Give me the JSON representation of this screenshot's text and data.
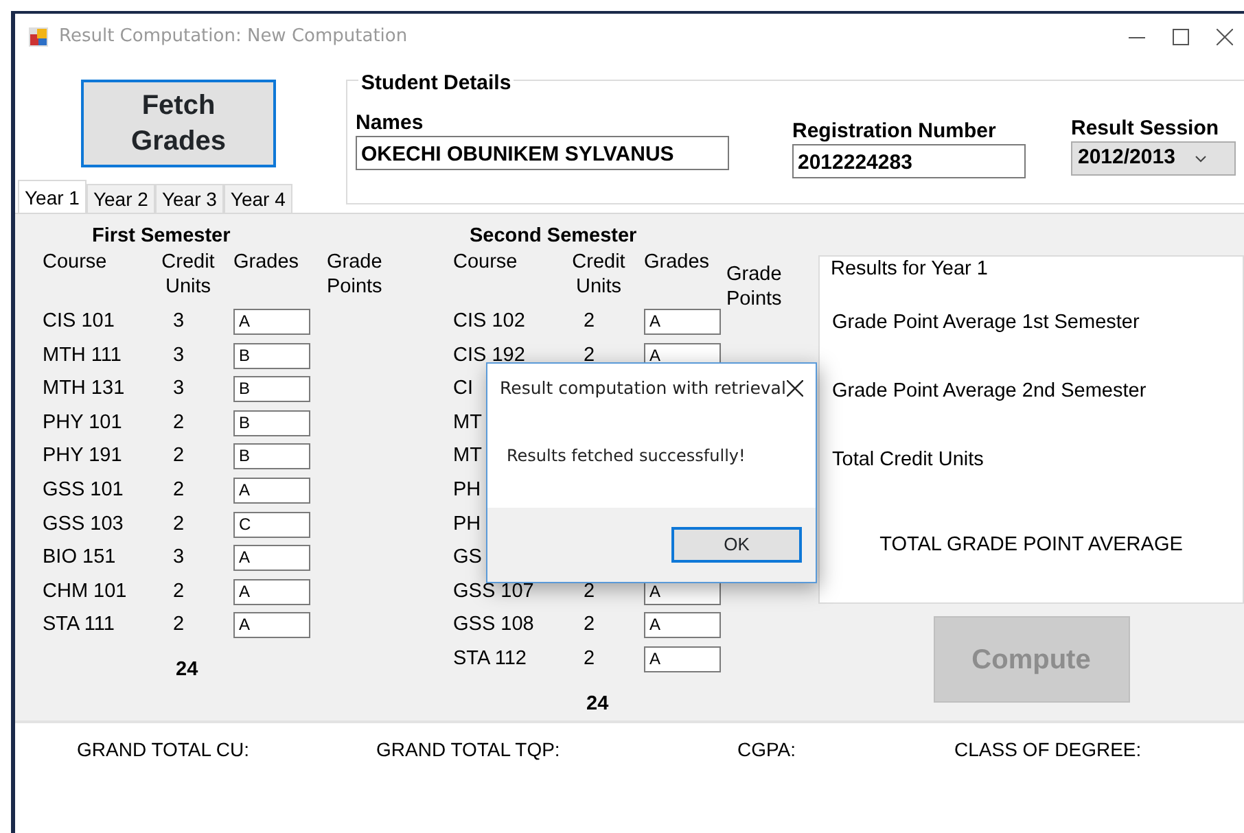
{
  "window": {
    "title": "Result Computation: New Computation"
  },
  "fetch_button": {
    "label": "Fetch Grades"
  },
  "student_details": {
    "title": "Student Details",
    "names": {
      "label": "Names",
      "value": "OKECHI OBUNIKEM SYLVANUS"
    },
    "registration": {
      "label": "Registration Number",
      "value": "2012224283"
    },
    "session": {
      "label": "Result Session",
      "value": "2012/2013"
    }
  },
  "tabs": [
    {
      "label": "Year 1",
      "selected": true
    },
    {
      "label": "Year 2",
      "selected": false
    },
    {
      "label": "Year 3",
      "selected": false
    },
    {
      "label": "Year 4",
      "selected": false
    }
  ],
  "semesters": [
    {
      "title": "First Semester",
      "columns": [
        "Course",
        "Credit Units",
        "Grades",
        "Grade Points"
      ],
      "total": "24",
      "rows": [
        {
          "course": "CIS 101",
          "credit_units": "3",
          "grade": "A"
        },
        {
          "course": "MTH 111",
          "credit_units": "3",
          "grade": "B"
        },
        {
          "course": "MTH 131",
          "credit_units": "3",
          "grade": "B"
        },
        {
          "course": "PHY 101",
          "credit_units": "2",
          "grade": "B"
        },
        {
          "course": "PHY 191",
          "credit_units": "2",
          "grade": "B"
        },
        {
          "course": "GSS 101",
          "credit_units": "2",
          "grade": "A"
        },
        {
          "course": "GSS 103",
          "credit_units": "2",
          "grade": "C"
        },
        {
          "course": "BIO 151",
          "credit_units": "3",
          "grade": "A"
        },
        {
          "course": "CHM 101",
          "credit_units": "2",
          "grade": "A"
        },
        {
          "course": "STA 111",
          "credit_units": "2",
          "grade": "A"
        }
      ]
    },
    {
      "title": "Second Semester",
      "columns": [
        "Course",
        "Credit Units",
        "Grades",
        "Grade Points"
      ],
      "total": "24",
      "rows": [
        {
          "course": "CIS 102",
          "credit_units": "2",
          "grade": "A"
        },
        {
          "course": "CIS 192",
          "credit_units": "2",
          "grade": "A"
        },
        {
          "course": "CI"
        },
        {
          "course": "MT"
        },
        {
          "course": "MT"
        },
        {
          "course": "PH"
        },
        {
          "course": "PH"
        },
        {
          "course": "GS"
        },
        {
          "course": "GSS 107",
          "credit_units": "2",
          "grade": "A"
        },
        {
          "course": "GSS 108",
          "credit_units": "2",
          "grade": "A"
        },
        {
          "course": "STA 112",
          "credit_units": "2",
          "grade": "A"
        }
      ]
    }
  ],
  "results": {
    "title": "Results for Year 1",
    "lines": [
      "Grade Point Average 1st Semester",
      "Grade Point Average 2nd Semester",
      "Total Credit Units"
    ],
    "total_label": "TOTAL GRADE POINT AVERAGE"
  },
  "compute_button": {
    "label": "Compute",
    "disabled": true
  },
  "summary": [
    "GRAND TOTAL CU:",
    "GRAND TOTAL TQP:",
    "CGPA:",
    "CLASS OF DEGREE:"
  ],
  "dialog": {
    "title": "Result computation with retrieval",
    "message": "Results fetched successfully!",
    "ok": "OK"
  }
}
